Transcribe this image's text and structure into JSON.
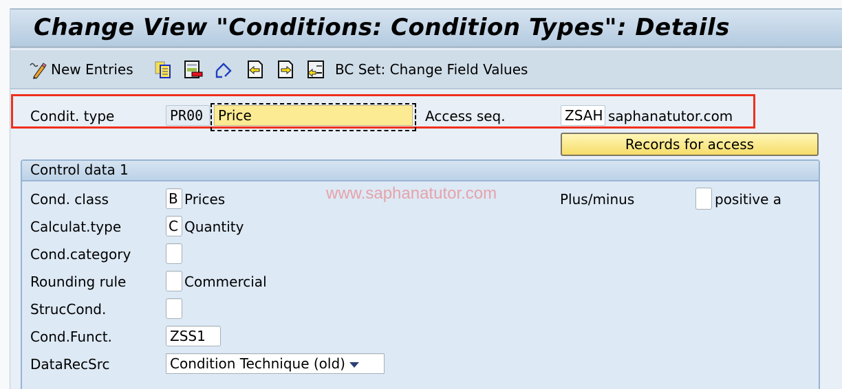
{
  "window": {
    "title": "Change View \"Conditions: Condition Types\": Details"
  },
  "toolbar": {
    "new_entries_label": "New Entries",
    "bc_set_label": "BC Set: Change Field Values",
    "icons": [
      "edit-pencil-icon",
      "copy-as-icon",
      "delete-icon",
      "undo-change-icon",
      "previous-entry-icon",
      "next-entry-icon",
      "select-all-icon"
    ]
  },
  "header": {
    "condit_type_label": "Condit. type",
    "condit_type_code": "PR00",
    "condit_type_desc": "Price",
    "access_seq_label": "Access seq.",
    "access_seq_code": "ZSAH",
    "access_seq_desc": "saphanatutor.com",
    "records_button": "Records for access",
    "highlight_color": "#ef2f1c"
  },
  "control_data_1": {
    "title": "Control data 1",
    "watermark": "www.saphanatutor.com",
    "fields": [
      {
        "label": "Cond. class",
        "value": "B",
        "desc": "Prices"
      },
      {
        "label": "Calculat.type",
        "value": "C",
        "desc": "Quantity"
      },
      {
        "label": "Cond.category",
        "value": "",
        "desc": ""
      },
      {
        "label": "Rounding rule",
        "value": "",
        "desc": "Commercial"
      },
      {
        "label": "StrucCond.",
        "value": "",
        "desc": ""
      },
      {
        "label": "Cond.Funct.",
        "value": "ZSS1",
        "desc": ""
      },
      {
        "label": "DataRecSrc",
        "value": "Condition Technique (old)",
        "desc": ""
      }
    ],
    "plus_minus_label": "Plus/minus",
    "plus_minus_value": "",
    "plus_minus_desc": "positive a"
  }
}
